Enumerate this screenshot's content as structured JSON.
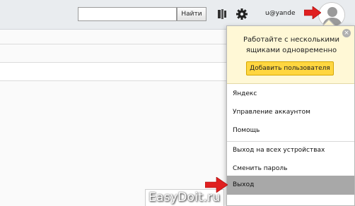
{
  "header": {
    "search": {
      "value": "",
      "placeholder": ""
    },
    "search_button": "Найти",
    "user_email": "u@yande",
    "icons": [
      "themes-icon",
      "gear-icon",
      "avatar-icon"
    ]
  },
  "popup": {
    "promo_text": "Работайте с несколькими ящиками одновременно",
    "promo_button": "Добавить пользователя",
    "close_glyph": "×",
    "groups": [
      [
        "Яндекс",
        "Управление аккаунтом",
        "Помощь"
      ],
      [
        "Выход на всех устройствах",
        "Сменить пароль"
      ],
      [
        "Выход"
      ]
    ],
    "active_item": "Выход"
  },
  "colors": {
    "promo_bg": "#fff8d6",
    "promo_button": "#ffd640",
    "active_item_bg": "#a8a8a8",
    "arrow": "#e02020"
  },
  "watermark": "EasyDoit.ru"
}
